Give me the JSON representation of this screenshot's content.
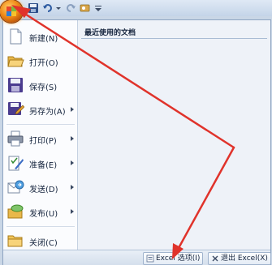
{
  "menu": {
    "items": [
      {
        "label": "新建(N)",
        "icon": "new-document-icon",
        "submenu": false
      },
      {
        "label": "打开(O)",
        "icon": "open-folder-icon",
        "submenu": false
      },
      {
        "label": "保存(S)",
        "icon": "save-icon",
        "submenu": false
      },
      {
        "label": "另存为(A)",
        "icon": "save-as-icon",
        "submenu": true
      },
      {
        "label": "打印(P)",
        "icon": "printer-icon",
        "submenu": true
      },
      {
        "label": "准备(E)",
        "icon": "prepare-icon",
        "submenu": true
      },
      {
        "label": "发送(D)",
        "icon": "send-icon",
        "submenu": true
      },
      {
        "label": "发布(U)",
        "icon": "publish-icon",
        "submenu": true
      },
      {
        "label": "关闭(C)",
        "icon": "close-folder-icon",
        "submenu": false
      }
    ]
  },
  "recent": {
    "title": "最近使用的文档"
  },
  "footer": {
    "options_label": "Excel 选项(I)",
    "exit_label": "退出 Excel(X)"
  },
  "colors": {
    "annotation_arrow": "#e0332b",
    "office_button": "#f08a17",
    "menu_background": "#f4f7fb"
  }
}
